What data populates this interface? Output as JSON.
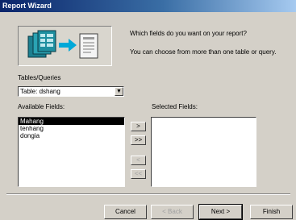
{
  "window": {
    "title": "Report Wizard"
  },
  "intro": {
    "question": "Which fields do you want on your report?",
    "hint": "You can choose from more than one table or query."
  },
  "source": {
    "label": "Tables/Queries",
    "selected": "Table: dshang"
  },
  "available": {
    "label": "Available Fields:",
    "items": [
      {
        "text": "Mahang",
        "selected": true
      },
      {
        "text": "tenhang",
        "selected": false
      },
      {
        "text": "dongia",
        "selected": false
      }
    ]
  },
  "selected_fields": {
    "label": "Selected Fields:",
    "items": []
  },
  "move_buttons": {
    "add_one": ">",
    "add_all": ">>",
    "remove_one": "<",
    "remove_all": "<<"
  },
  "buttons": {
    "cancel": "Cancel",
    "back": "< Back",
    "next": "Next >",
    "finish": "Finish"
  },
  "colors": {
    "titlebar_start": "#0a246a",
    "titlebar_end": "#a6caf0",
    "face": "#d4d0c8"
  }
}
